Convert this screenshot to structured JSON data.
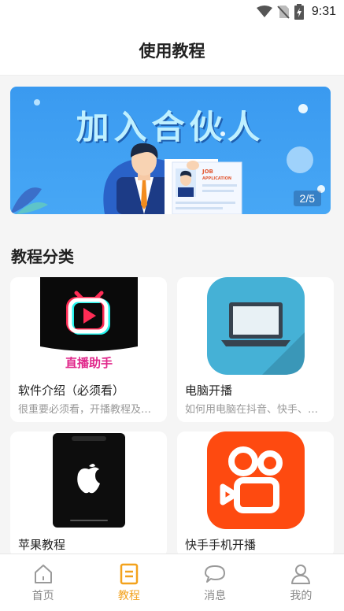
{
  "status_bar": {
    "time": "9:31"
  },
  "header": {
    "title": "使用教程"
  },
  "banner": {
    "title": "加入合伙人",
    "indicator": "2/5",
    "doc_label_1": "JOB",
    "doc_label_2": "APPLICATION"
  },
  "section": {
    "title": "教程分类"
  },
  "cards": [
    {
      "title": "软件介绍（必须看）",
      "desc": "很重要必须看，开播教程及…",
      "thumb_text": "直播助手"
    },
    {
      "title": "电脑开播",
      "desc": "如何用电脑在抖音、快手、…"
    },
    {
      "title": "苹果教程",
      "desc": ""
    },
    {
      "title": "快手手机开播",
      "desc": ""
    }
  ],
  "tabbar": [
    {
      "label": "首页",
      "icon": "home-icon"
    },
    {
      "label": "教程",
      "icon": "document-icon"
    },
    {
      "label": "消息",
      "icon": "chat-bubble-icon"
    },
    {
      "label": "我的",
      "icon": "user-icon"
    }
  ],
  "colors": {
    "accent": "#f3a21c",
    "banner_blue": "#3a9af0",
    "kuaishou_orange": "#fe4a10"
  }
}
